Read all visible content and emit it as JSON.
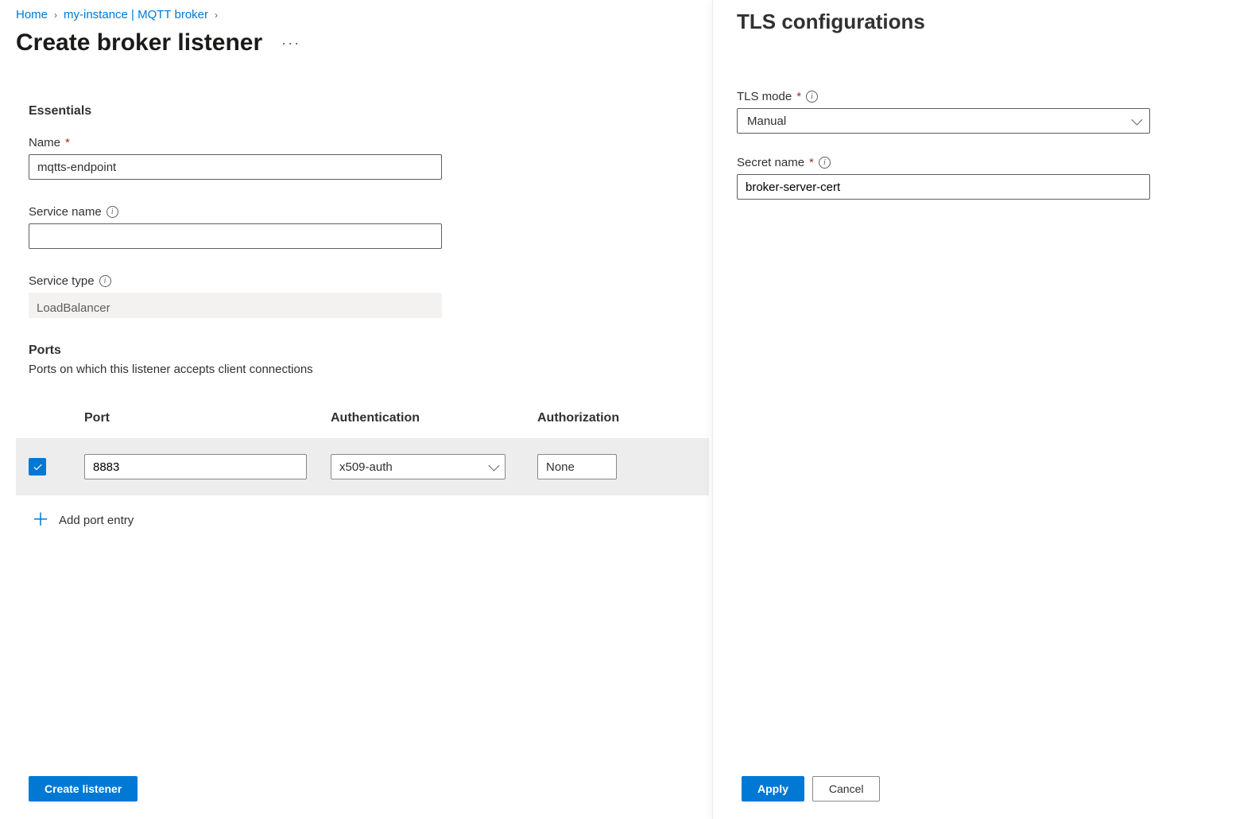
{
  "breadcrumb": {
    "home": "Home",
    "instance": "my-instance | MQTT broker"
  },
  "page_title": "Create broker listener",
  "essentials": {
    "heading": "Essentials",
    "name_label": "Name",
    "name_value": "mqtts-endpoint",
    "service_name_label": "Service name",
    "service_name_value": "",
    "service_type_label": "Service type",
    "service_type_value": "LoadBalancer"
  },
  "ports": {
    "heading": "Ports",
    "desc": "Ports on which this listener accepts client connections",
    "columns": {
      "c1": "Port",
      "c2": "Authentication",
      "c3": "Authorization"
    },
    "row": {
      "port": "8883",
      "auth": "x509-auth",
      "authz": "None"
    },
    "add_label": "Add port entry"
  },
  "main_footer": {
    "create": "Create listener"
  },
  "panel": {
    "title": "TLS configurations",
    "tls_mode_label": "TLS mode",
    "tls_mode_value": "Manual",
    "secret_name_label": "Secret name",
    "secret_name_value": "broker-server-cert",
    "apply": "Apply",
    "cancel": "Cancel"
  }
}
